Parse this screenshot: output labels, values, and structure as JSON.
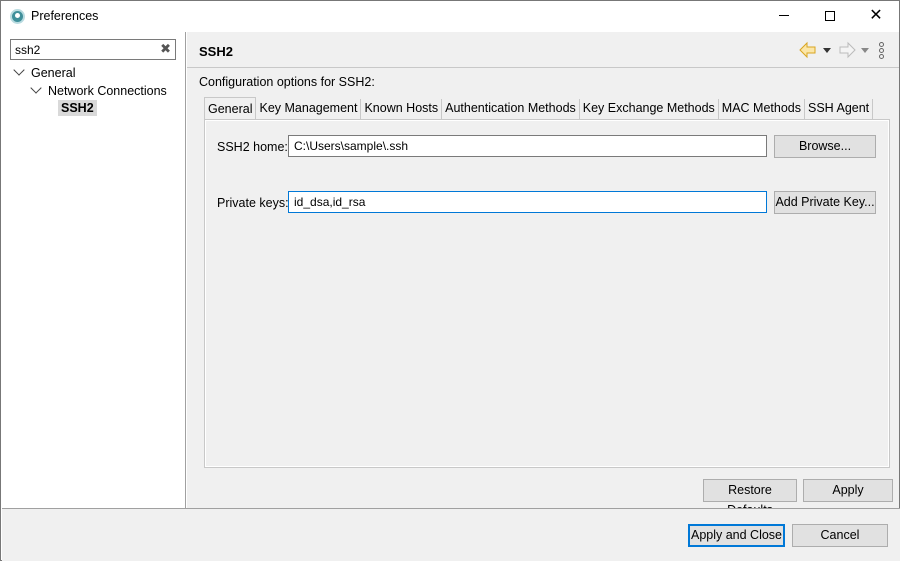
{
  "window": {
    "title": "Preferences",
    "controls": {
      "minimize": "minimize",
      "maximize": "maximize",
      "close": "close"
    }
  },
  "sidebar": {
    "filter": {
      "value": "ssh2",
      "placeholder": ""
    },
    "tree": [
      {
        "label": "General",
        "expanded": true,
        "level": 0
      },
      {
        "label": "Network Connections",
        "expanded": true,
        "level": 1
      },
      {
        "label": "SSH2",
        "selected": true,
        "level": 2
      }
    ]
  },
  "page": {
    "title": "SSH2",
    "description": "Configuration options for SSH2:",
    "tabs": [
      {
        "label": "General",
        "active": true
      },
      {
        "label": "Key Management"
      },
      {
        "label": "Known Hosts"
      },
      {
        "label": "Authentication Methods"
      },
      {
        "label": "Key Exchange Methods"
      },
      {
        "label": "MAC Methods"
      },
      {
        "label": "SSH Agent"
      }
    ],
    "general": {
      "ssh2_home_label": "SSH2 home:",
      "ssh2_home_value": "C:\\Users\\sample\\.ssh",
      "browse_label": "Browse...",
      "private_keys_label": "Private keys:",
      "private_keys_value": "id_dsa,id_rsa",
      "add_private_key_label": "Add Private Key..."
    },
    "restore_defaults_label": "Restore Defaults",
    "apply_label": "Apply"
  },
  "footer": {
    "apply_close_label": "Apply and Close",
    "cancel_label": "Cancel"
  },
  "colors": {
    "accent": "#0078d7",
    "back_arrow": "#f5c542"
  }
}
